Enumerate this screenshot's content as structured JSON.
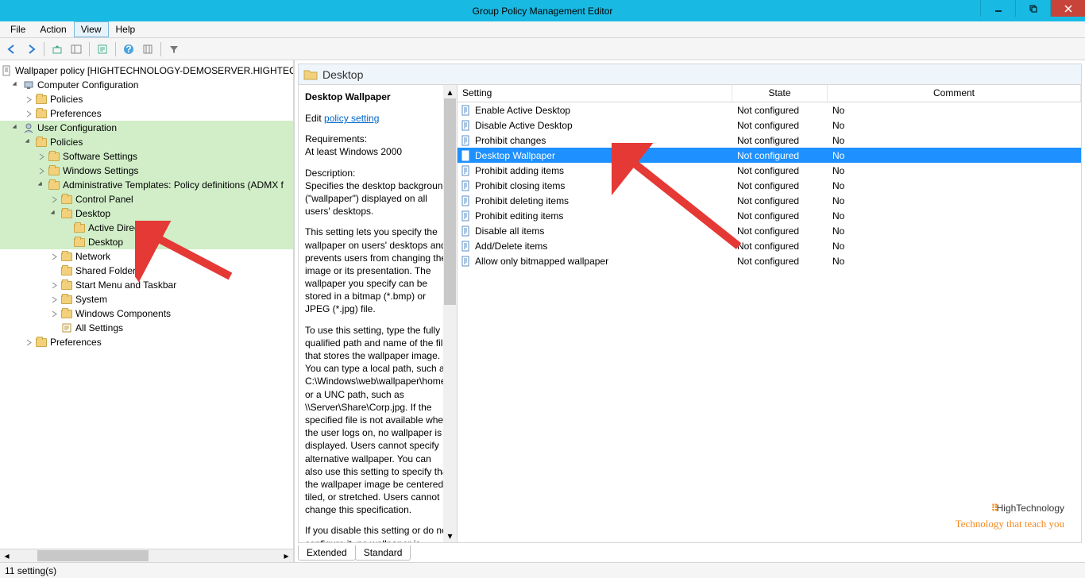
{
  "window": {
    "title": "Group Policy Management Editor"
  },
  "menu": {
    "items": [
      "File",
      "Action",
      "View",
      "Help"
    ],
    "active_index": 2
  },
  "tree": {
    "root": "Wallpaper policy [HIGHTECHNOLOGY-DEMOSERVER.HIGHTECH",
    "computer_config": "Computer Configuration",
    "cc_policies": "Policies",
    "cc_prefs": "Preferences",
    "user_config": "User Configuration",
    "uc_policies": "Policies",
    "sw_settings": "Software Settings",
    "win_settings": "Windows Settings",
    "admin_templates": "Administrative Templates: Policy definitions (ADMX f",
    "control_panel": "Control Panel",
    "desktop": "Desktop",
    "active_directory": "Active Directory",
    "desktop_sub": "Desktop",
    "network": "Network",
    "shared_folders": "Shared Folders",
    "start_menu": "Start Menu and Taskbar",
    "system": "System",
    "win_components": "Windows Components",
    "all_settings": "All Settings",
    "uc_prefs": "Preferences"
  },
  "crumb": {
    "title": "Desktop"
  },
  "desc": {
    "heading": "Desktop Wallpaper",
    "edit_prefix": "Edit ",
    "edit_link": "policy setting ",
    "req_label": "Requirements:",
    "req_value": "At least Windows 2000",
    "desc_label": "Description:",
    "p1": "Specifies the desktop background (\"wallpaper\") displayed on all users' desktops.",
    "p2": "This setting lets you specify the wallpaper on users' desktops and prevents users from changing the image or its presentation. The wallpaper you specify can be stored in a bitmap (*.bmp) or JPEG (*.jpg) file.",
    "p3": "To use this setting, type the fully qualified path and name of the file that stores the wallpaper image. You can type a local path, such as C:\\Windows\\web\\wallpaper\\home.jpg or a UNC path, such as \\\\Server\\Share\\Corp.jpg. If the specified file is not available when the user logs on, no wallpaper is displayed. Users cannot specify alternative wallpaper. You can also use this setting to specify that the wallpaper image be centered, tiled, or stretched. Users cannot change this specification.",
    "p4": "If you disable this setting or do not configure it, no wallpaper is"
  },
  "list": {
    "cols": {
      "c1": "Setting",
      "c2": "State",
      "c3": "Comment"
    },
    "rows": [
      {
        "name": "Enable Active Desktop",
        "state": "Not configured",
        "comment": "No"
      },
      {
        "name": "Disable Active Desktop",
        "state": "Not configured",
        "comment": "No"
      },
      {
        "name": "Prohibit changes",
        "state": "Not configured",
        "comment": "No"
      },
      {
        "name": "Desktop Wallpaper",
        "state": "Not configured",
        "comment": "No"
      },
      {
        "name": "Prohibit adding items",
        "state": "Not configured",
        "comment": "No"
      },
      {
        "name": "Prohibit closing items",
        "state": "Not configured",
        "comment": "No"
      },
      {
        "name": "Prohibit deleting items",
        "state": "Not configured",
        "comment": "No"
      },
      {
        "name": "Prohibit editing items",
        "state": "Not configured",
        "comment": "No"
      },
      {
        "name": "Disable all items",
        "state": "Not configured",
        "comment": "No"
      },
      {
        "name": "Add/Delete items",
        "state": "Not configured",
        "comment": "No"
      },
      {
        "name": "Allow only bitmapped wallpaper",
        "state": "Not configured",
        "comment": "No"
      }
    ],
    "selected_index": 3
  },
  "tabs": {
    "extended": "Extended",
    "standard": "Standard"
  },
  "status": {
    "text": "11 setting(s)"
  },
  "watermark": {
    "brand": "HighTechnology",
    "tag": "Technology that teach you"
  }
}
